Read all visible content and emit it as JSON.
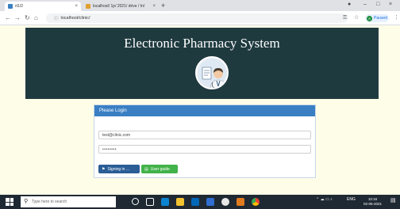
{
  "browser": {
    "tabs": [
      {
        "label": "rt1/2",
        "active": true
      },
      {
        "label": "localhost/ 1p/ 2021/ drive / In/",
        "active": false
      }
    ],
    "new_tab": "+",
    "url": "localhost/clinic/",
    "paused_label": "Paused",
    "profile_initial": "A"
  },
  "header": {
    "title": "Electronic Pharmacy System",
    "logo_icon": "doctor-icon"
  },
  "login": {
    "heading": "Please Login",
    "email_value": "test@clinic.com",
    "password_value": "••••••••",
    "signin_label": "Signing in ...",
    "guide_label": "User guide"
  },
  "taskbar": {
    "search_placeholder": "Type here to search",
    "language": "ENG",
    "time": "10:16",
    "date": "02-05-2021"
  },
  "colors": {
    "hero_bg": "#1f3a3f",
    "panel_header": "#3a7fc3",
    "signin_button": "#2b5d96",
    "guide_button": "#42b24a",
    "page_bg": "#fefee8"
  }
}
